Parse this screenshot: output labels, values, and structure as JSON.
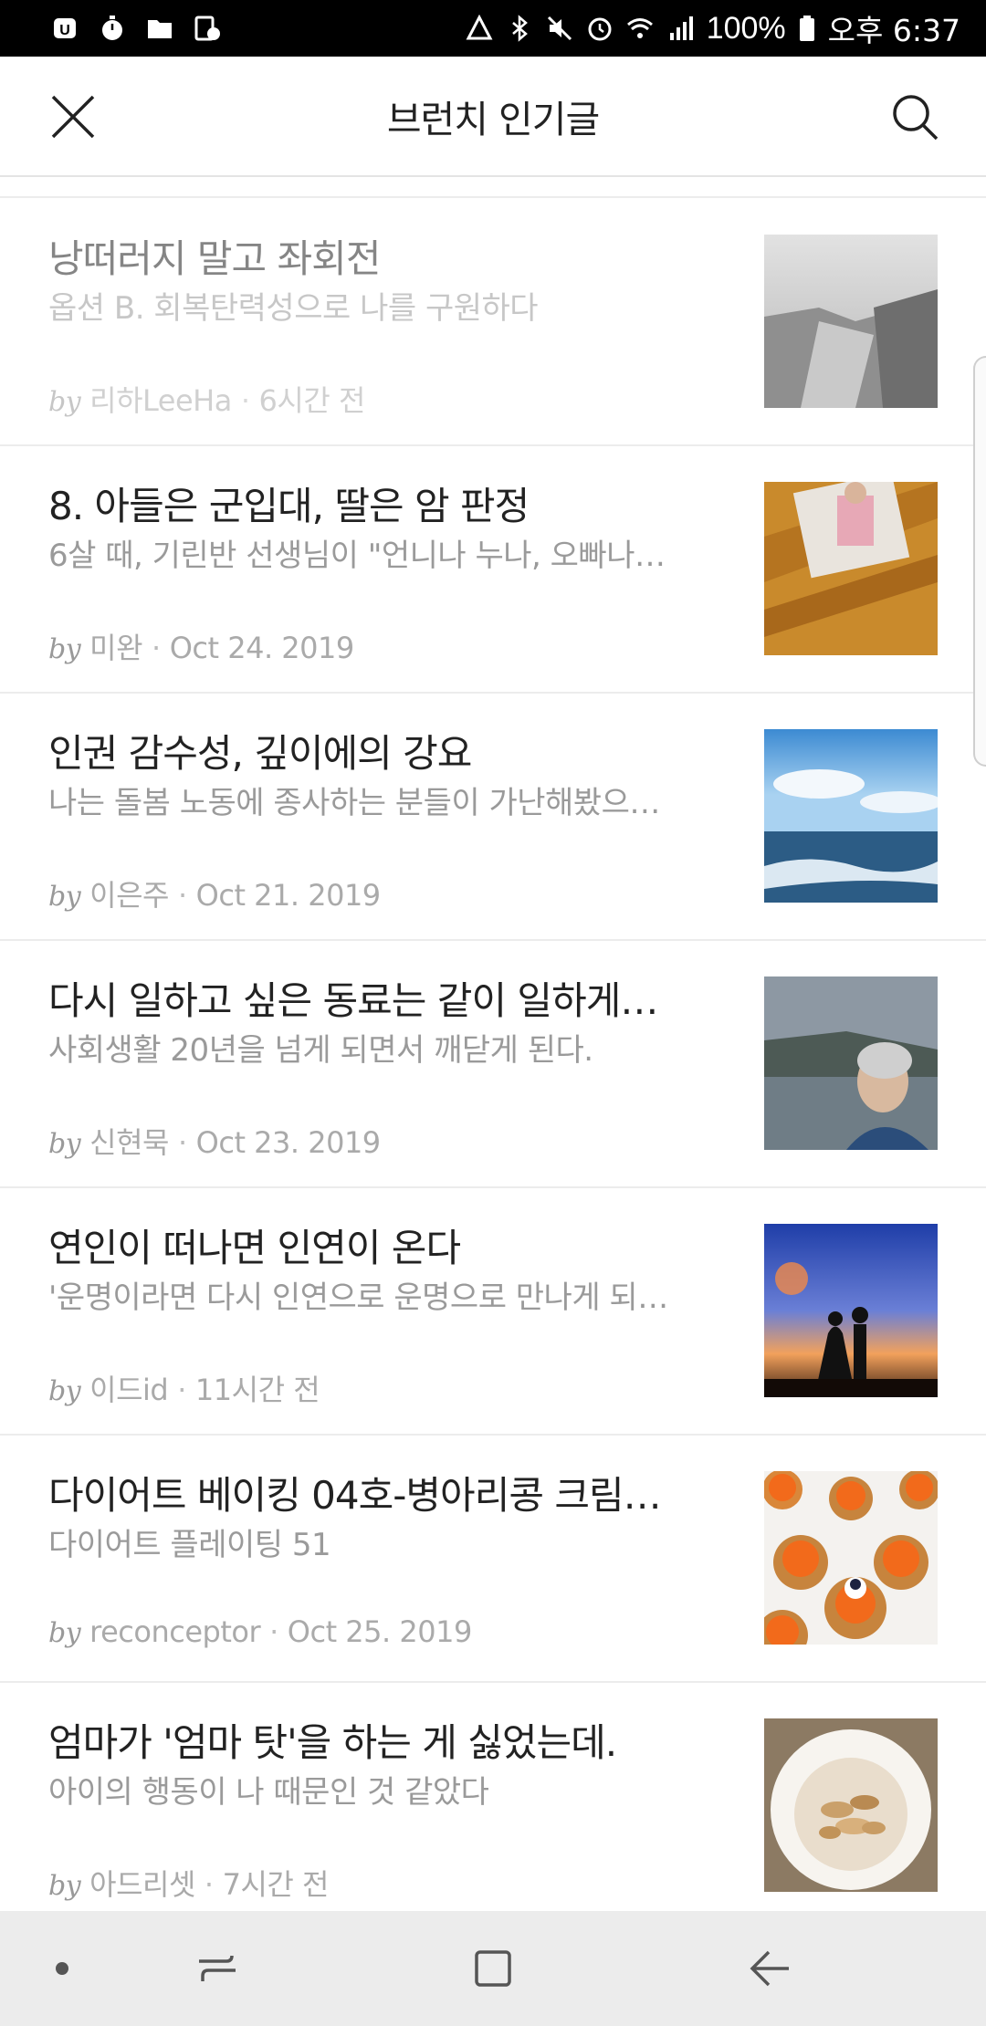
{
  "status_bar": {
    "battery": "100%",
    "time": "오후 6:37"
  },
  "header": {
    "title": "브런치 인기글"
  },
  "articles": [
    {
      "title": "낭떠러지 말고 좌회전",
      "subtitle": "옵션 B. 회복탄력성으로 나를 구원하다",
      "by": "by",
      "author": "리하LeeHa",
      "date": "6시간 전",
      "thumb": "cliff-photo"
    },
    {
      "title": "8. 아들은 군입대, 딸은 암 판정",
      "subtitle": "6살 때, 기린반 선생님이 \"언니나 누나, 오빠나…",
      "by": "by",
      "author": "미완",
      "date": "Oct 24. 2019",
      "thumb": "child-photo"
    },
    {
      "title": "인권 감수성, 깊이에의 강요",
      "subtitle": "나는 돌봄 노동에 종사하는 분들이 가난해봤으…",
      "by": "by",
      "author": "이은주",
      "date": "Oct 21. 2019",
      "thumb": "sea-photo"
    },
    {
      "title": "다시 일하고 싶은 동료는 같이 일하게…",
      "subtitle": "사회생활 20년을 넘게 되면서 깨닫게 된다.",
      "by": "by",
      "author": "신현묵",
      "date": "Oct 23. 2019",
      "thumb": "man-photo"
    },
    {
      "title": "연인이 떠나면 인연이 온다",
      "subtitle": "'운명이라면 다시 인연으로 운명으로 만나게 되…",
      "by": "by",
      "author": "이드id",
      "date": "11시간 전",
      "thumb": "couple-photo"
    },
    {
      "title": "다이어트 베이킹 04호-병아리콩 크림…",
      "subtitle": "다이어트 플레이팅 51",
      "by": "by",
      "author": "reconceptor",
      "date": "Oct 25. 2019",
      "thumb": "baking-photo"
    },
    {
      "title": "엄마가 '엄마 탓'을 하는 게 싫었는데.",
      "subtitle": "아이의 행동이 나 때문인 것 같았다",
      "by": "by",
      "author": "아드리셋",
      "date": "7시간 전",
      "thumb": "bowl-photo"
    }
  ]
}
